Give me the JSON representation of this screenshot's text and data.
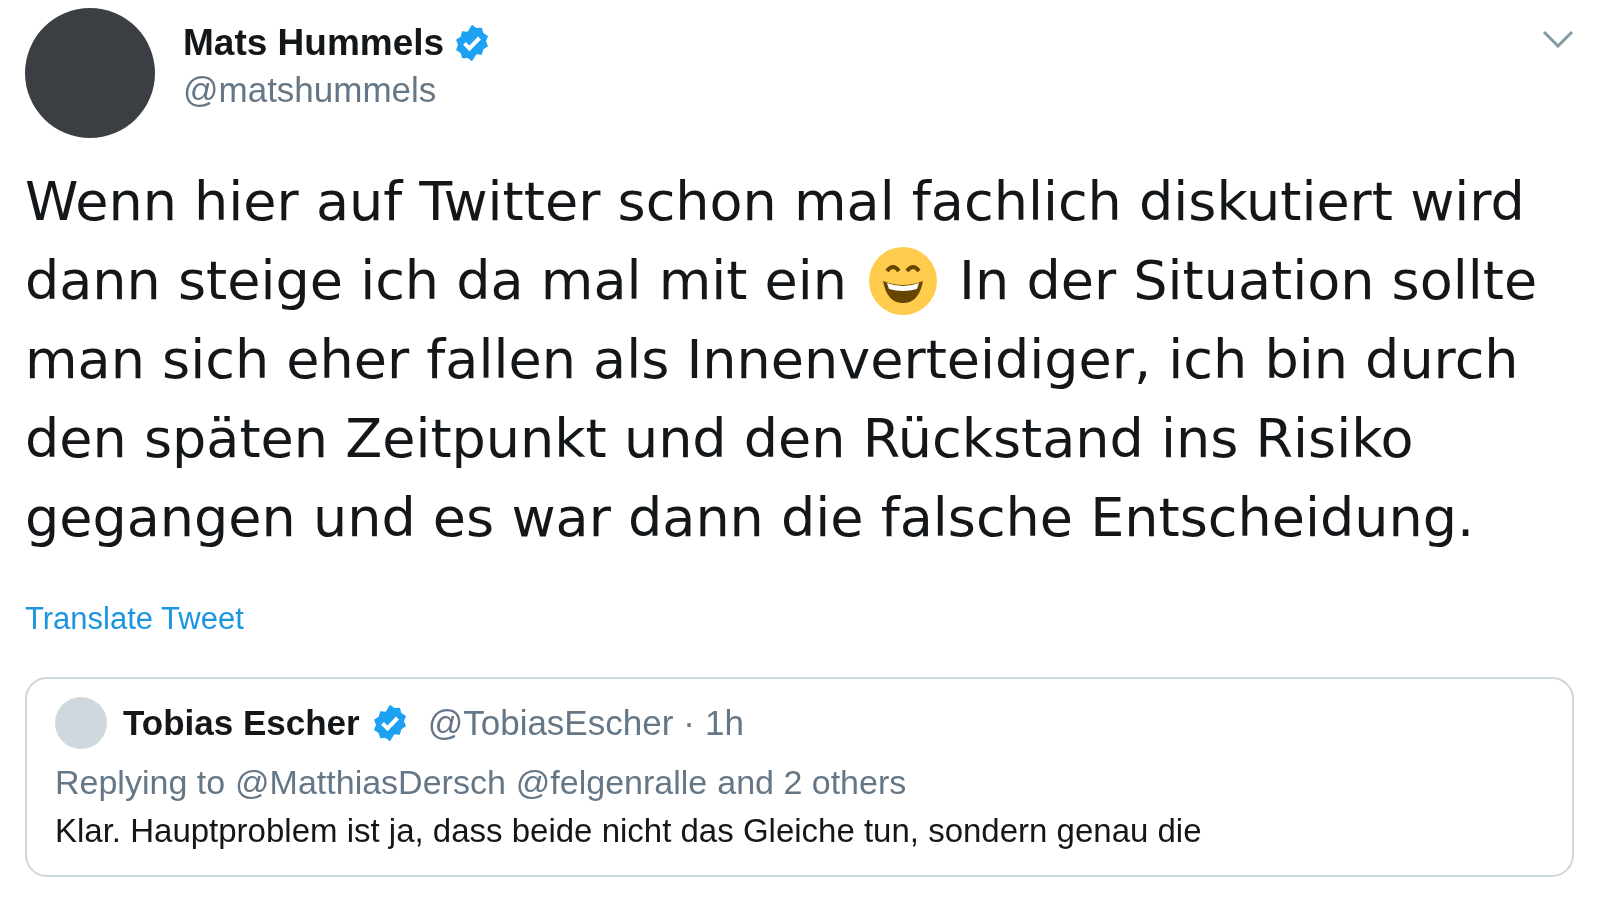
{
  "tweet": {
    "author": {
      "name": "Mats Hummels",
      "handle": "@matshummels",
      "verified": true
    },
    "text_lines": [
      [
        "Wenn hier auf Twitter schon mal fachlich diskutiert wird"
      ],
      [
        "dann steige ich da mal mit ein",
        "In der Situation sollte"
      ],
      [
        "man sich eher fallen als Innenverteidiger, ich bin durch"
      ],
      [
        "den späten Zeitpunkt und den Rückstand ins Risiko"
      ],
      [
        "gegangen und es war dann die falsche Entscheidung."
      ]
    ],
    "translate_link": "Translate Tweet",
    "quoted_tweet": {
      "author": {
        "name": "Tobias Escher",
        "handle": "@TobiasEscher",
        "verified": true
      },
      "separator": "·",
      "time": "1h",
      "reply_prefix": "Replying to",
      "reply_targets": [
        "@MatthiasDersch",
        "@felgenralle"
      ],
      "reply_suffix": "and 2 others",
      "text": "Klar. Hauptproblem ist ja, dass beide nicht das Gleiche tun, sondern genau die"
    }
  }
}
